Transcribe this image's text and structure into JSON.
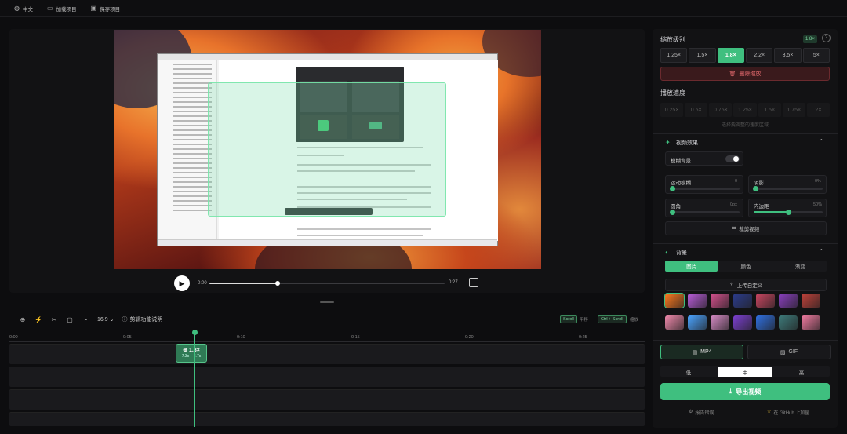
{
  "topbar": {
    "language": "中文",
    "load_project": "加载项目",
    "save_project": "保存项目"
  },
  "player": {
    "current_time": "0:00",
    "duration": "0:27",
    "progress_fraction": 0.29
  },
  "timeline_toolbar": {
    "aspect_ratio": "16:9",
    "help_label": "剪辑功能说明",
    "scroll_key": "Scroll",
    "scroll_action": "平移",
    "zoom_key": "Ctrl + Scroll",
    "zoom_action": "缩放"
  },
  "ruler": {
    "ticks": [
      "0:00",
      "0:05",
      "0:10",
      "0:15",
      "0:20",
      "0:25"
    ]
  },
  "zoom_clip": {
    "level": "1.8×",
    "range": "7.3s – 8.7s"
  },
  "tracks": {
    "placeholder_1": "",
    "placeholder_2": "",
    "placeholder_3": ""
  },
  "panel": {
    "zoom_level_title": "缩放级别",
    "zoom_badge": "1.8×",
    "zoom_options": [
      "1.25×",
      "1.5×",
      "1.8×",
      "2.2×",
      "3.5×",
      "5×"
    ],
    "zoom_selected": "1.8×",
    "delete_zoom": "删除缩放",
    "speed_title": "播放速度",
    "speed_options": [
      "0.25×",
      "0.5×",
      "0.75×",
      "1.25×",
      "1.5×",
      "1.75×",
      "2×"
    ],
    "speed_hint": "选择要调整的速度区域",
    "video_effects_title": "视频效果",
    "blur_bg_label": "模糊背景",
    "motion_blur_label": "运动模糊",
    "motion_blur_value": "0",
    "motion_blur_fraction": 0.02,
    "shadow_label": "阴影",
    "shadow_value": "0%",
    "shadow_fraction": 0.02,
    "corner_label": "圆角",
    "corner_value": "0px",
    "corner_fraction": 0.02,
    "padding_label": "内边距",
    "padding_value": "50%",
    "padding_fraction": 0.5,
    "crop_label": "裁剪视频",
    "background_title": "背景",
    "bg_tabs": [
      "图片",
      "颜色",
      "渐变"
    ],
    "bg_tab_selected": "图片",
    "upload_label": "上传自定义",
    "swatches": [
      "#ff7a1f",
      "#b95cd9",
      "#d4508e",
      "#2b3b8c",
      "#c94560",
      "#8a3fbf",
      "#c0413a",
      "#e8a",
      "#4aa3ff",
      "#d58ac4",
      "#7b3fd0",
      "#2f6fe0",
      "#3d7a7a",
      "#f07aa0"
    ],
    "format_mp4": "MP4",
    "format_gif": "GIF",
    "quality_options": [
      "低",
      "中",
      "高"
    ],
    "quality_selected": "中",
    "export_label": "导出视频",
    "report_issue": "报告错误",
    "github_star": "在 GitHub 上加星"
  },
  "colors": {
    "accent": "#3fbf7f",
    "danger": "#e46a6e"
  }
}
